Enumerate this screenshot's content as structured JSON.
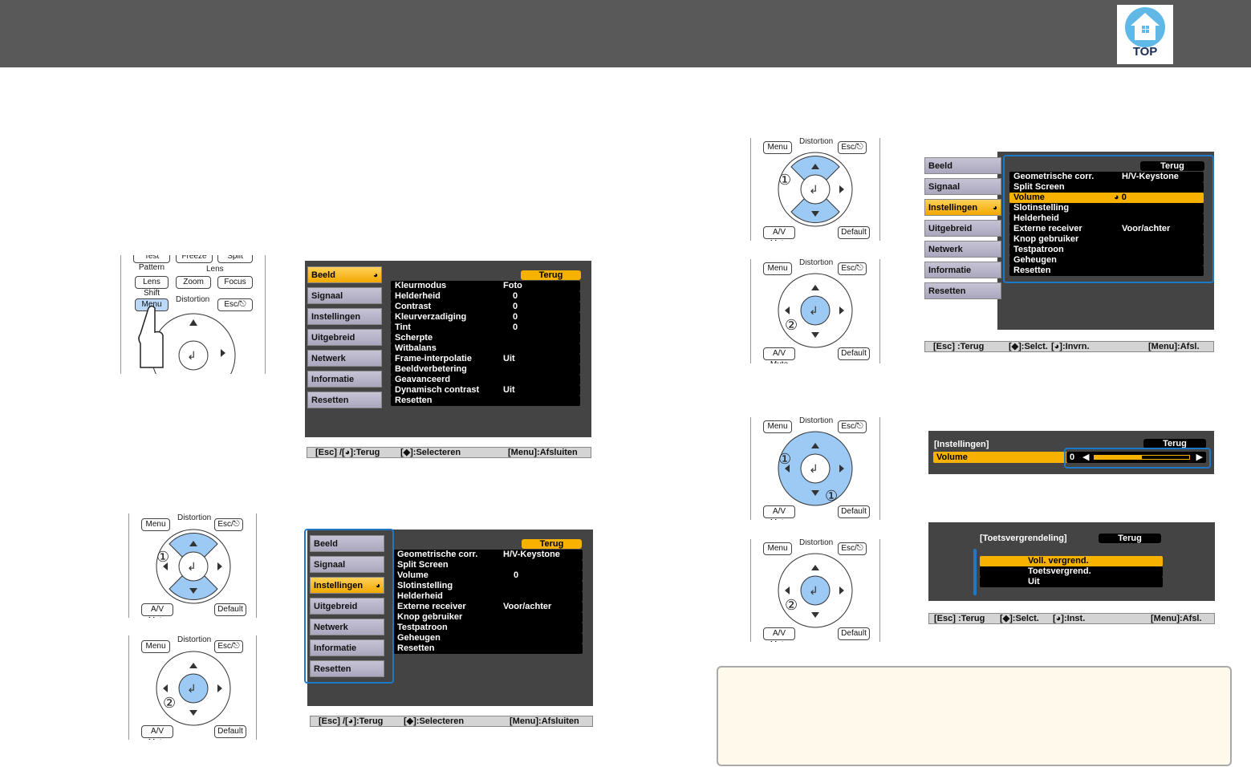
{
  "header": {
    "logo_text": "TOP"
  },
  "remote_labels": {
    "test_pattern": "Test Pattern",
    "freeze": "Freeze",
    "split": "Split",
    "lens": "Lens",
    "lens_shift": "Lens Shift",
    "zoom": "Zoom",
    "focus": "Focus",
    "menu": "Menu",
    "distortion": "Distortion",
    "esc": "Esc/⎋",
    "av_mute": "A/V Mute",
    "default": "Default",
    "step1": "①",
    "step2": "②"
  },
  "menu_sidebar": [
    "Beeld",
    "Signaal",
    "Instellingen",
    "Uitgebreid",
    "Netwerk",
    "Informatie",
    "Resetten"
  ],
  "menu1": {
    "back": "Terug",
    "rows": [
      {
        "label": "Kleurmodus",
        "value": "Foto"
      },
      {
        "label": "Helderheid",
        "value": "0"
      },
      {
        "label": "Contrast",
        "value": "0"
      },
      {
        "label": "Kleurverzadiging",
        "value": "0"
      },
      {
        "label": "Tint",
        "value": "0"
      },
      {
        "label": "Scherpte",
        "value": ""
      },
      {
        "label": "Witbalans",
        "value": ""
      },
      {
        "label": "Frame-interpolatie",
        "value": "Uit"
      },
      {
        "label": "Beeldverbetering",
        "value": ""
      },
      {
        "label": "Geavanceerd",
        "value": ""
      },
      {
        "label": "Dynamisch contrast",
        "value": "Uit"
      },
      {
        "label": "Resetten",
        "value": ""
      }
    ],
    "status": {
      "left": "[Esc] /[◕]:Terug",
      "mid": "[◆]:Selecteren",
      "right": "[Menu]:Afsluiten"
    }
  },
  "menu2": {
    "back": "Terug",
    "rows": [
      {
        "label": "Geometrische corr.",
        "value": "H/V-Keystone"
      },
      {
        "label": "Split Screen",
        "value": ""
      },
      {
        "label": "Volume",
        "value": "0"
      },
      {
        "label": "Slotinstelling",
        "value": ""
      },
      {
        "label": "Helderheid",
        "value": ""
      },
      {
        "label": "Externe receiver",
        "value": "Voor/achter"
      },
      {
        "label": "Knop gebruiker",
        "value": ""
      },
      {
        "label": "Testpatroon",
        "value": ""
      },
      {
        "label": "Geheugen",
        "value": ""
      },
      {
        "label": "Resetten",
        "value": ""
      }
    ],
    "status": {
      "left": "[Esc] /[◕]:Terug",
      "mid": "[◆]:Selecteren",
      "right": "[Menu]:Afsluiten"
    }
  },
  "menu3": {
    "back": "Terug",
    "rows": [
      {
        "label": "Geometrische corr.",
        "value": "H/V-Keystone"
      },
      {
        "label": "Split Screen",
        "value": ""
      },
      {
        "label": "Volume",
        "value": "◕  0"
      },
      {
        "label": "Slotinstelling",
        "value": ""
      },
      {
        "label": "Helderheid",
        "value": ""
      },
      {
        "label": "Externe receiver",
        "value": "Voor/achter"
      },
      {
        "label": "Knop gebruiker",
        "value": ""
      },
      {
        "label": "Testpatroon",
        "value": ""
      },
      {
        "label": "Geheugen",
        "value": ""
      },
      {
        "label": "Resetten",
        "value": ""
      }
    ],
    "status": {
      "left": "[Esc] :Terug",
      "mid": "[◆]:Selct.",
      "mid2": "[◕]:Invrn.",
      "right": "[Menu]:Afsl."
    }
  },
  "volume_dialog": {
    "title": "[Instellingen]",
    "back": "Terug",
    "label": "Volume",
    "value": "0",
    "level": 0.5
  },
  "lock_dialog": {
    "title": "[Toetsvergrendeling]",
    "back": "Terug",
    "options": [
      "Voll. vergrend.",
      "Toetsvergrend.",
      "Uit"
    ],
    "status": {
      "left": "[Esc] :Terug",
      "mid": "[◆]:Selct.",
      "mid2": "[◕]:Inst.",
      "right": "[Menu]:Afsl."
    }
  }
}
